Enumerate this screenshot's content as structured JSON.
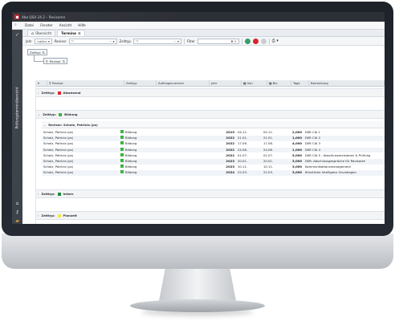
{
  "window": {
    "title": "Abo QSA 24.2 – Revisoren"
  },
  "menu": {
    "items": [
      "Datei",
      "Fenster",
      "Ansicht",
      "Hilfe"
    ]
  },
  "sidebar": {
    "title": "Prüfungsterminübersicht"
  },
  "tabs": [
    {
      "label": "Übersicht"
    },
    {
      "label": "Termine"
    }
  ],
  "toolbar": {
    "jahr_label": "Jahr",
    "jahr_value": "<alle>",
    "revisor_label": "Revisor",
    "revisor_value": "\"\"",
    "zeittyp_label": "Zeittyp",
    "zeittyp_value": "\"\"",
    "filter_label": "Filter"
  },
  "grouping": {
    "level1": "Zeittyp",
    "level2": "Revisor"
  },
  "columns": [
    "Revisor",
    "Zeittyp",
    "Auftragsnummer",
    "Jahr",
    "Von",
    "Bis",
    "Tage",
    "Bemerkung"
  ],
  "colors": {
    "abwesend": "#d9242c",
    "bildung": "#3db341",
    "intern": "#1e8a3a",
    "planzeit": "#f2e74a"
  },
  "groups": {
    "abwesend": {
      "label": "Zeittyp:",
      "value": "Abwesend"
    },
    "bildung": {
      "label": "Zeittyp:",
      "value": "Bildung"
    },
    "revisor": {
      "label": "Revisor: Scholz, Patricia (ps)"
    },
    "intern": {
      "label": "Zeittyp:",
      "value": "Intern"
    },
    "planzeit": {
      "label": "Zeittyp:",
      "value": "Planzeit"
    }
  },
  "rows": [
    {
      "revisor": "Scholz, Patricia (ps)",
      "zeittyp": "Bildung",
      "auftrag": "",
      "jahr": "2019",
      "von": "04.11.",
      "bis": "05.11.",
      "tage": "2,000",
      "bemerkung": "DIIR CIA 1"
    },
    {
      "revisor": "Scholz, Patricia (ps)",
      "zeittyp": "Bildung",
      "auftrag": "",
      "jahr": "2022",
      "von": "21.01.",
      "bis": "21.01.",
      "tage": "1,000",
      "bemerkung": "DIIR CIA 2"
    },
    {
      "revisor": "Scholz, Patricia (ps)",
      "zeittyp": "Bildung",
      "auftrag": "",
      "jahr": "2022",
      "von": "17.06.",
      "bis": "17.06.",
      "tage": "4,000",
      "bemerkung": "DIIR CIA 3"
    },
    {
      "revisor": "Scholz, Patricia (ps)",
      "zeittyp": "Bildung",
      "auftrag": "",
      "jahr": "2022",
      "von": "24.06.",
      "bis": "24.06.",
      "tage": "1,000",
      "bemerkung": "DIIR CIA 4"
    },
    {
      "revisor": "Scholz, Patricia (ps)",
      "zeittyp": "Bildung",
      "auftrag": "",
      "jahr": "2022",
      "von": "01.07.",
      "bis": "01.07.",
      "tage": "5,000",
      "bemerkung": "DIIR CIA 5 - Abschlussrevisionen & Prüfung"
    },
    {
      "revisor": "Scholz, Patricia (ps)",
      "zeittyp": "Bildung",
      "auftrag": "",
      "jahr": "2023",
      "von": "20.01.",
      "bis": "20.01.",
      "tage": "3,000",
      "bemerkung": "DIIR: Abschlussgespräche für Revisoren"
    },
    {
      "revisor": "Scholz, Patricia (ps)",
      "zeittyp": "Bildung",
      "auftrag": "",
      "jahr": "2023",
      "von": "10.11.",
      "bis": "10.11.",
      "tage": "3,000",
      "bemerkung": "Kommunikationsmanagement"
    },
    {
      "revisor": "Scholz, Patricia (ps)",
      "zeittyp": "Bildung",
      "auftrag": "",
      "jahr": "2024",
      "von": "22.03.",
      "bis": "22.03.",
      "tage": "3,000",
      "bemerkung": "Künstliche Intelligenz Grundlagen"
    }
  ]
}
